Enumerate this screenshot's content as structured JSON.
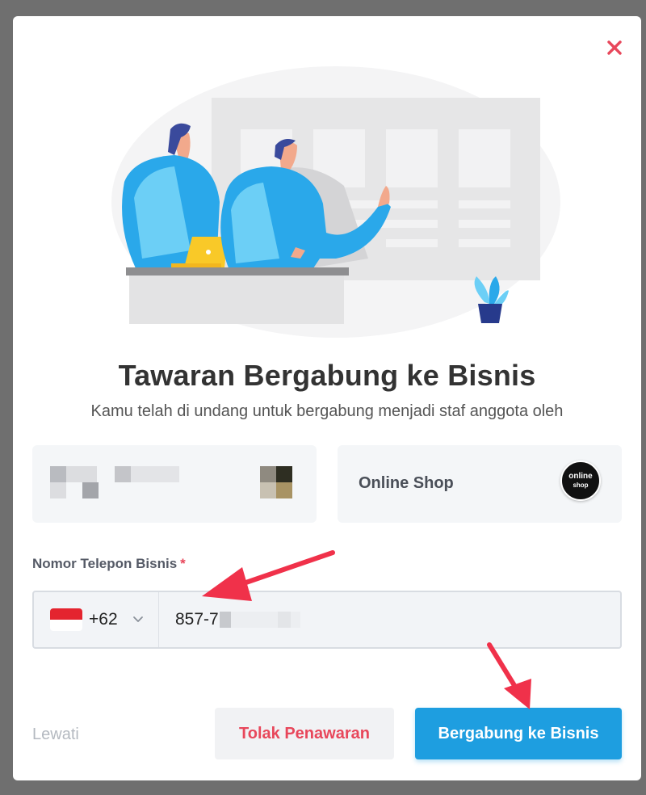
{
  "dialog": {
    "title": "Tawaran Bergabung ke Bisnis",
    "subtitle": "Kamu telah di undang untuk bergabung menjadi staf anggota oleh"
  },
  "inviter": {
    "name": "",
    "avatar": ""
  },
  "business": {
    "name": "Online Shop",
    "logo_line1": "online",
    "logo_line2": "shop"
  },
  "phone_field": {
    "label": "Nomor Telepon Bisnis",
    "required_mark": "*",
    "country_code": "+62",
    "country_flag": "indonesia-flag",
    "value": "857-7"
  },
  "actions": {
    "skip_label": "Lewati",
    "reject_label": "Tolak Penawaran",
    "join_label": "Bergabung ke Bisnis"
  },
  "colors": {
    "accent": "#1e9ee0",
    "danger": "#e8475b",
    "annotation_arrow": "#f0314a"
  },
  "icons": {
    "close": "close-icon",
    "dropdown": "chevron-down-icon"
  }
}
